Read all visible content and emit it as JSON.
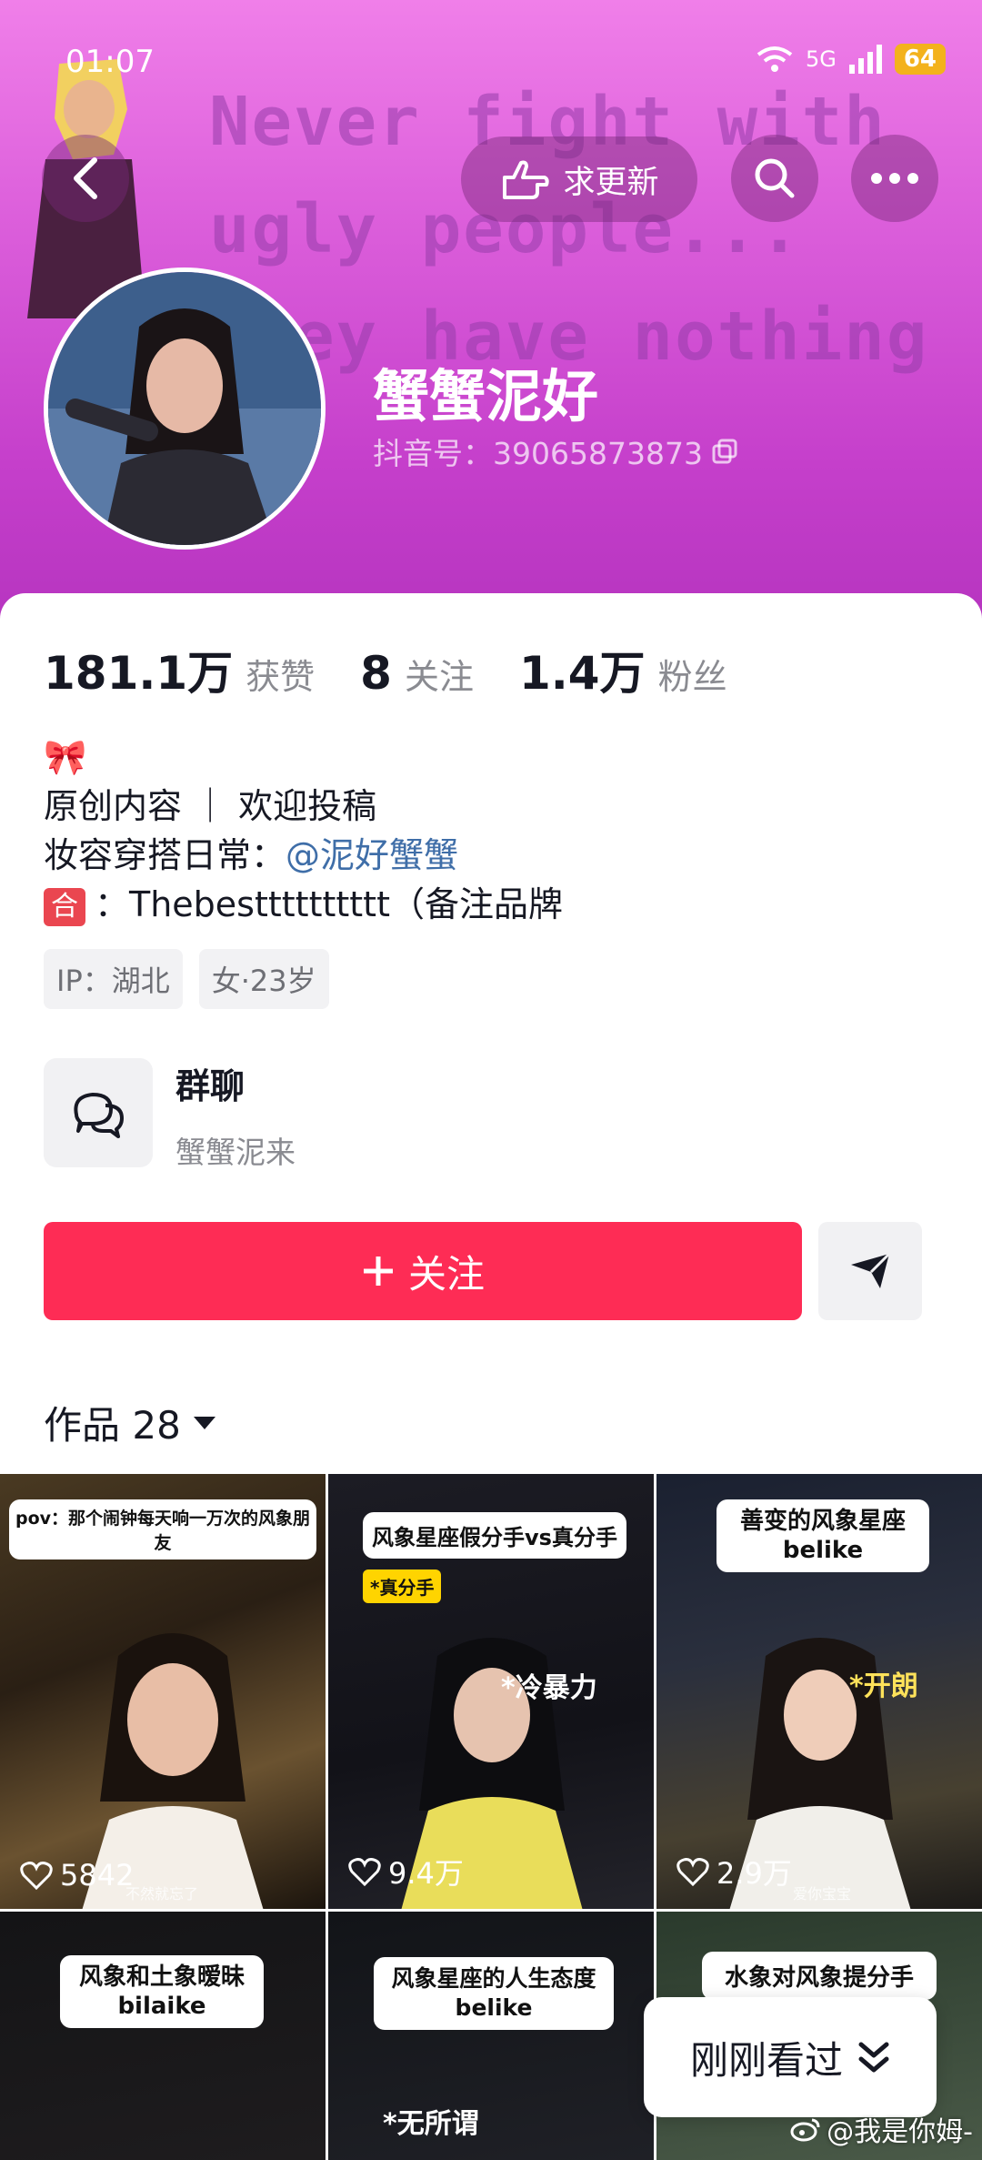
{
  "status_bar": {
    "time": "01:07",
    "network": "5G",
    "battery": "64"
  },
  "header": {
    "banner_lines": [
      "Never fight with",
      "ugly people...",
      "they have nothing"
    ],
    "request_update_label": "求更新",
    "nickname": "蟹蟹泥好",
    "douyin_id": "抖音号：39065873873"
  },
  "stats": [
    {
      "value": "181.1万",
      "label": "获赞"
    },
    {
      "value": "8",
      "label": "关注"
    },
    {
      "value": "1.4万",
      "label": "粉丝"
    }
  ],
  "bio": {
    "emoji": "🎀",
    "line1": "原创内容 ｜ 欢迎投稿",
    "line2_prefix": "妆容穿搭日常：",
    "line2_mention": "@泥好蟹蟹",
    "line3_badge": "合",
    "line3_text": "：Thebestttttttttt（备注品牌"
  },
  "tags": [
    "IP：湖北",
    "女·23岁"
  ],
  "group_chat": {
    "title": "群聊",
    "subtitle": "蟹蟹泥来"
  },
  "follow_label": "关注",
  "works_tab": "作品 28",
  "videos": [
    {
      "caption": "pov：那个闹钟每天响一万次的风象朋友",
      "likes": "5842",
      "sub": "不然就忘了"
    },
    {
      "caption": "风象星座假分手vs真分手",
      "tag": "*真分手",
      "overlay": "*冷暴力",
      "likes": "9.4万"
    },
    {
      "caption_l1": "善变的风象星座",
      "caption_l2": "belike",
      "overlay": "*开朗",
      "likes": "2.9万",
      "sub": "爱你宝宝"
    },
    {
      "caption_l1": "风象和土象暧昧",
      "caption_l2": "bilaike"
    },
    {
      "caption_l1": "风象星座的人生态度",
      "caption_l2": "belike",
      "overlay": "*无所谓"
    },
    {
      "caption_l1": "水象对风象提分手"
    }
  ],
  "recent_label": "刚刚看过",
  "watermark": "@我是你姆-",
  "colors": {
    "follow": "#fe2c55",
    "banner": "#d65ad6",
    "mention": "#3f6ea8"
  }
}
